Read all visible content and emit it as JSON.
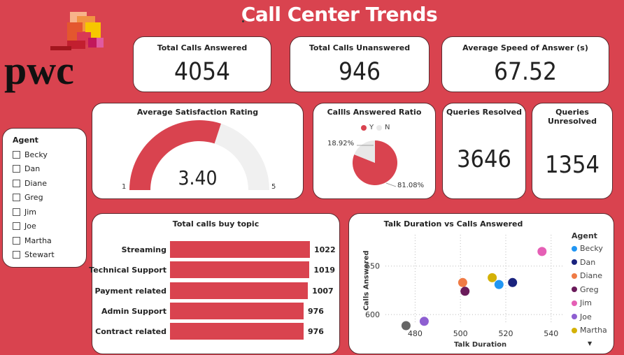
{
  "title": "Call Center Trends",
  "kpis": {
    "total_answered": {
      "label": "Total Calls Answered",
      "value": "4054"
    },
    "total_unanswered": {
      "label": "Total Calls Unanswered",
      "value": "946"
    },
    "avg_speed": {
      "label": "Average Speed of Answer (s)",
      "value": "67.52"
    },
    "queries_resolved": {
      "label": "Queries Resolved",
      "value": "3646"
    },
    "queries_unresolved": {
      "label": "Queries Unresolved",
      "value": "1354"
    }
  },
  "gauge": {
    "label": "Average Satisfaction Rating",
    "value": "3.40",
    "min": "1",
    "max": "5",
    "level": 0.6,
    "fill_color": "#d9434f",
    "track_color": "#f0f0f0"
  },
  "ratio": {
    "label": "Callls Answered Ratio",
    "legend_y": "Y",
    "legend_n": "N",
    "pct_n": "18.92%",
    "pct_y": "81.08%",
    "y_color": "#d9434f",
    "n_color": "#e8e8e8"
  },
  "slicer": {
    "title": "Agent",
    "items": [
      "Becky",
      "Dan",
      "Diane",
      "Greg",
      "Jim",
      "Joe",
      "Martha",
      "Stewart"
    ]
  },
  "topics": {
    "title": "Total calls buy topic",
    "rows": [
      {
        "label": "Streaming",
        "value": "1022"
      },
      {
        "label": "Technical Support",
        "value": "1019"
      },
      {
        "label": "Payment related",
        "value": "1007"
      },
      {
        "label": "Admin Support",
        "value": "976"
      },
      {
        "label": "Contract related",
        "value": "976"
      }
    ]
  },
  "scatter": {
    "title": "Talk Duration vs Calls Answered",
    "legend_title": "Agent",
    "xlabel": "Talk Duration",
    "ylabel": "Calls Answered",
    "x_ticks": [
      "480",
      "500",
      "520",
      "540"
    ],
    "y_ticks": [
      "600",
      "650"
    ]
  },
  "chart_data": {
    "type": "scatter",
    "title": "Talk Duration vs Calls Answered",
    "xlabel": "Talk Duration",
    "ylabel": "Calls Answered",
    "xlim": [
      470,
      545
    ],
    "ylim": [
      590,
      675
    ],
    "legend_placement": "right",
    "grid": true,
    "series": [
      {
        "name": "Becky",
        "color": "#2196f3",
        "x": 517,
        "y": 631
      },
      {
        "name": "Dan",
        "color": "#1a237e",
        "x": 523,
        "y": 633
      },
      {
        "name": "Diane",
        "color": "#ef7b45",
        "x": 501,
        "y": 633
      },
      {
        "name": "Greg",
        "color": "#6a1b5a",
        "x": 502,
        "y": 624
      },
      {
        "name": "Jim",
        "color": "#e55fb5",
        "x": 536,
        "y": 665
      },
      {
        "name": "Joe",
        "color": "#8e5fd1",
        "x": 484,
        "y": 593
      },
      {
        "name": "Martha",
        "color": "#d4b106",
        "x": 514,
        "y": 638
      },
      {
        "name": "Stewart",
        "color": "#666666",
        "x": 476,
        "y": 582
      }
    ]
  }
}
